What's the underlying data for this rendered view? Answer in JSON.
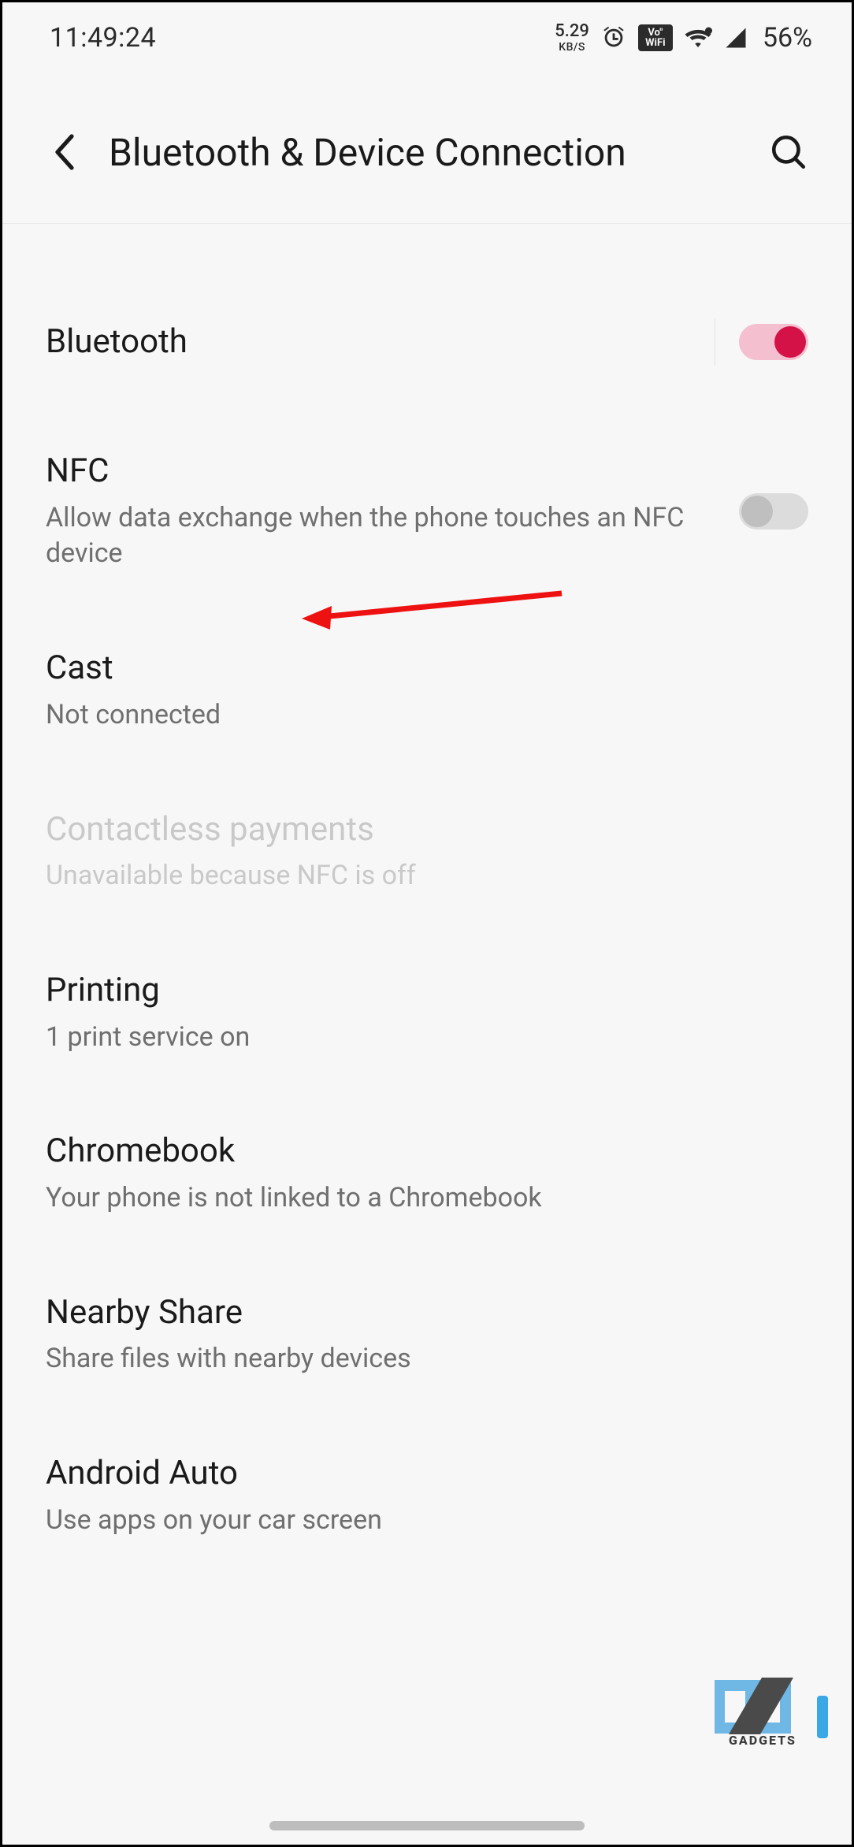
{
  "status": {
    "time": "11:49:24",
    "net_speed_value": "5.29",
    "net_speed_unit": "KB/S",
    "vowifi_top": "Vo\"",
    "vowifi_bottom": "WiFi",
    "battery_pct": "56%"
  },
  "header": {
    "title": "Bluetooth & Device Connection"
  },
  "rows": {
    "bluetooth": {
      "title": "Bluetooth",
      "toggle_on": true
    },
    "nfc": {
      "title": "NFC",
      "sub": "Allow data exchange when the phone touches an NFC device",
      "toggle_on": false
    },
    "cast": {
      "title": "Cast",
      "sub": "Not connected"
    },
    "contactless": {
      "title": "Contactless payments",
      "sub": "Unavailable because NFC is off"
    },
    "printing": {
      "title": "Printing",
      "sub": "1 print service on"
    },
    "chromebook": {
      "title": "Chromebook",
      "sub": "Your phone is not linked to a Chromebook"
    },
    "nearby": {
      "title": "Nearby Share",
      "sub": "Share files with nearby devices"
    },
    "auto": {
      "title": "Android Auto",
      "sub": "Use apps on your car screen"
    }
  },
  "watermark": {
    "text": "GADGETS"
  }
}
